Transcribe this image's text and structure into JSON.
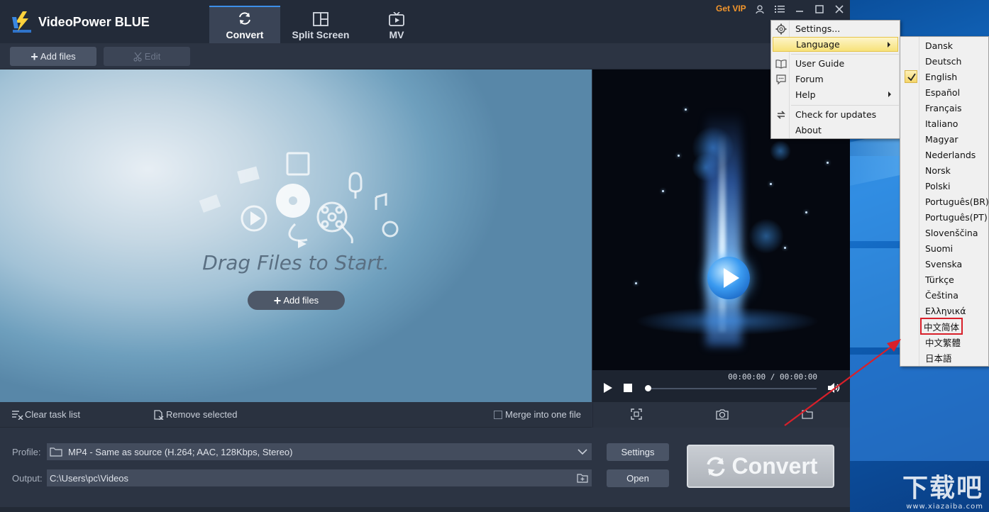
{
  "app": {
    "title": "VideoPower BLUE",
    "get_vip": "Get VIP"
  },
  "tabs": [
    {
      "label": "Convert",
      "icon": "refresh-icon",
      "active": true
    },
    {
      "label": "Split Screen",
      "icon": "split-screen-icon",
      "active": false
    },
    {
      "label": "MV",
      "icon": "tv-icon",
      "active": false
    }
  ],
  "toolbar": {
    "add_files": "Add files",
    "edit": "Edit"
  },
  "dropzone": {
    "text": "Drag Files to Start.",
    "add_files": "Add files"
  },
  "player": {
    "timecode": "00:00:00 / 00:00:00"
  },
  "tasklist": {
    "clear": "Clear task list",
    "remove": "Remove selected",
    "merge": "Merge into one file"
  },
  "bottom": {
    "profile_label": "Profile:",
    "profile_value": "MP4 - Same as source (H.264; AAC, 128Kbps, Stereo)",
    "output_label": "Output:",
    "output_value": "C:\\Users\\pc\\Videos",
    "settings": "Settings",
    "open": "Open",
    "convert": "Convert"
  },
  "menu": {
    "settings": "Settings...",
    "language": "Language",
    "user_guide": "User Guide",
    "forum": "Forum",
    "help": "Help",
    "check_updates": "Check for updates",
    "about": "About"
  },
  "languages": [
    "Dansk",
    "Deutsch",
    "English",
    "Español",
    "Français",
    "Italiano",
    "Magyar",
    "Nederlands",
    "Norsk",
    "Polski",
    "Português(BR)",
    "Português(PT)",
    "Slovenščina",
    "Suomi",
    "Svenska",
    "Türkçe",
    "Čeština",
    "Ελληνικά",
    "中文简体",
    "中文繁體",
    "日本語"
  ],
  "selected_language": "English",
  "highlighted_language": "中文简体",
  "watermark": {
    "big": "下载吧",
    "small": "www.xiazaiba.com"
  },
  "colors": {
    "accent": "#3d8fe8",
    "vip": "#f3962c",
    "highlight_box": "#d8202a"
  }
}
